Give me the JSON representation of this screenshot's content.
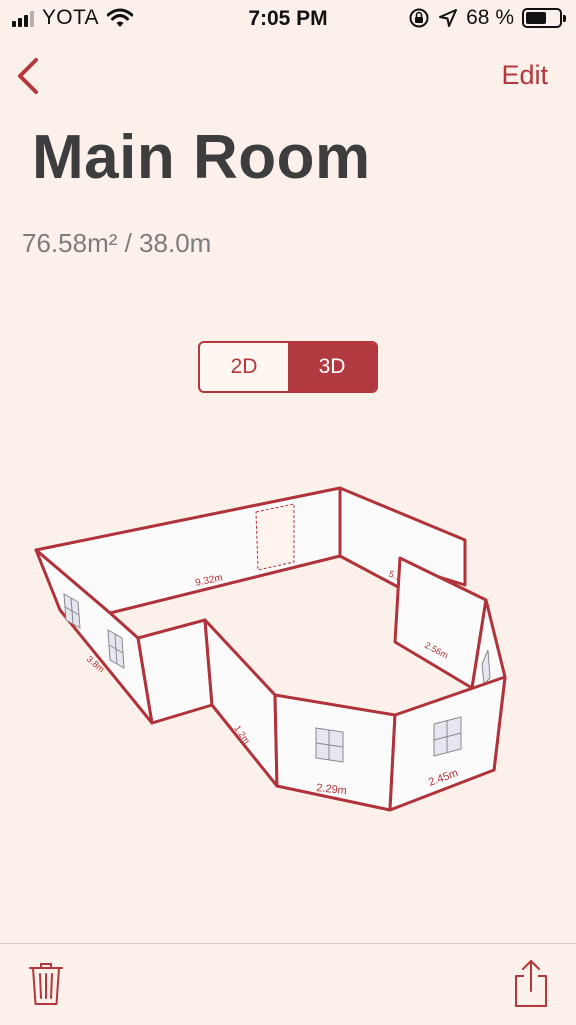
{
  "status_bar": {
    "carrier": "YOTA",
    "time": "7:05 PM",
    "battery_percent": "68 %",
    "battery_level": 0.68
  },
  "nav": {
    "back_icon": "chevron-left-icon",
    "edit_label": "Edit"
  },
  "room": {
    "title": "Main Room",
    "summary": "76.58m² / 38.0m"
  },
  "view_toggle": {
    "options": [
      "2D",
      "3D"
    ],
    "selected": "3D"
  },
  "plan": {
    "wall_labels": [
      "9.32m",
      "5.1",
      "2.56m",
      "3.8m",
      "1.2m",
      "2.29m",
      "2.45m"
    ]
  },
  "toolbar": {
    "delete_icon": "trash-icon",
    "share_icon": "share-icon"
  },
  "colors": {
    "accent": "#b5363c",
    "background": "#fcf1ea",
    "title": "#3d3d3d",
    "subtitle": "#7c7c7c"
  }
}
